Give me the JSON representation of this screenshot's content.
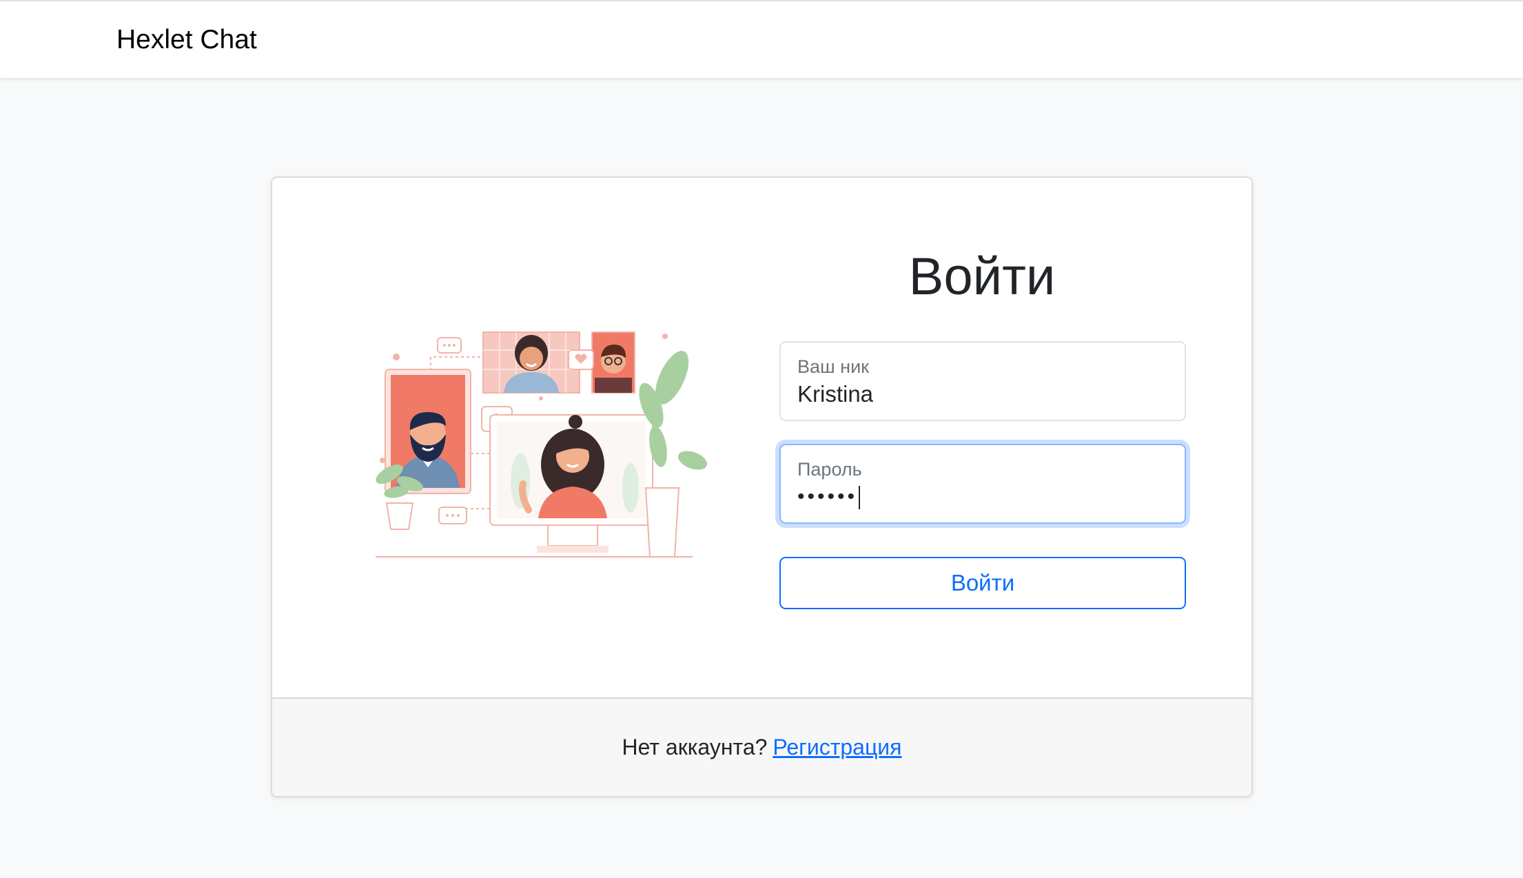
{
  "navbar": {
    "brand": "Hexlet Chat"
  },
  "login": {
    "title": "Войти",
    "username": {
      "label": "Ваш ник",
      "value": "Kristina"
    },
    "password": {
      "label": "Пароль",
      "masked_value": "••••••"
    },
    "submit_label": "Войти"
  },
  "footer": {
    "question": "Нет аккаунта?",
    "signup_link": "Регистрация"
  },
  "colors": {
    "primary": "#0d6efd",
    "background": "#f8f9fa",
    "illustration_coral": "#f07a66",
    "illustration_green": "#a8cfa0"
  },
  "icons": {
    "illustration": "video-chat-illustration"
  }
}
